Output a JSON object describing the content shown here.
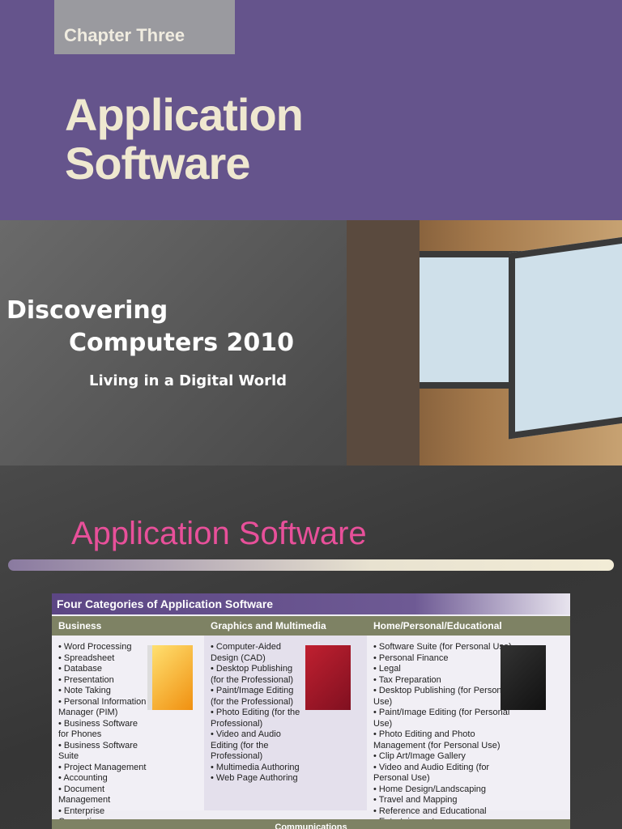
{
  "slide1": {
    "chapter": "Chapter Three",
    "title_line1": "Application",
    "title_line2": "Software",
    "brand_line1": "Discovering",
    "brand_line2": "Computers 2010",
    "tagline": "Living in a Digital World"
  },
  "slide2": {
    "title": "Application Software",
    "figure": {
      "heading": "Four Categories of Application Software",
      "columns": [
        {
          "header": "Business",
          "items": [
            "Word Processing",
            "Spreadsheet",
            "Database",
            "Presentation",
            "Note Taking",
            "Personal Information Manager (PIM)",
            "Business Software for Phones",
            "Business Software Suite",
            "Project Management",
            "Accounting",
            "Document Management",
            "Enterprise Computing"
          ]
        },
        {
          "header": "Graphics and Multimedia",
          "items": [
            "Computer-Aided Design (CAD)",
            "Desktop Publishing (for the Professional)",
            "Paint/Image Editing (for the Professional)",
            "Photo Editing (for the Professional)",
            "Video and Audio Editing (for the Professional)",
            "Multimedia Authoring",
            "Web Page Authoring"
          ]
        },
        {
          "header": "Home/Personal/Educational",
          "items": [
            "Software Suite (for Personal Use)",
            "Personal Finance",
            "Legal",
            "Tax Preparation",
            "Desktop Publishing (for Personal Use)",
            "Paint/Image Editing (for Personal Use)",
            "Photo Editing and Photo Management (for Personal Use)",
            "Clip Art/Image Gallery",
            "Video and Audio Editing (for Personal Use)",
            "Home Design/Landscaping",
            "Travel and Mapping",
            "Reference and Educational",
            "Entertainment"
          ]
        }
      ],
      "bottom_header": "Communications"
    }
  }
}
